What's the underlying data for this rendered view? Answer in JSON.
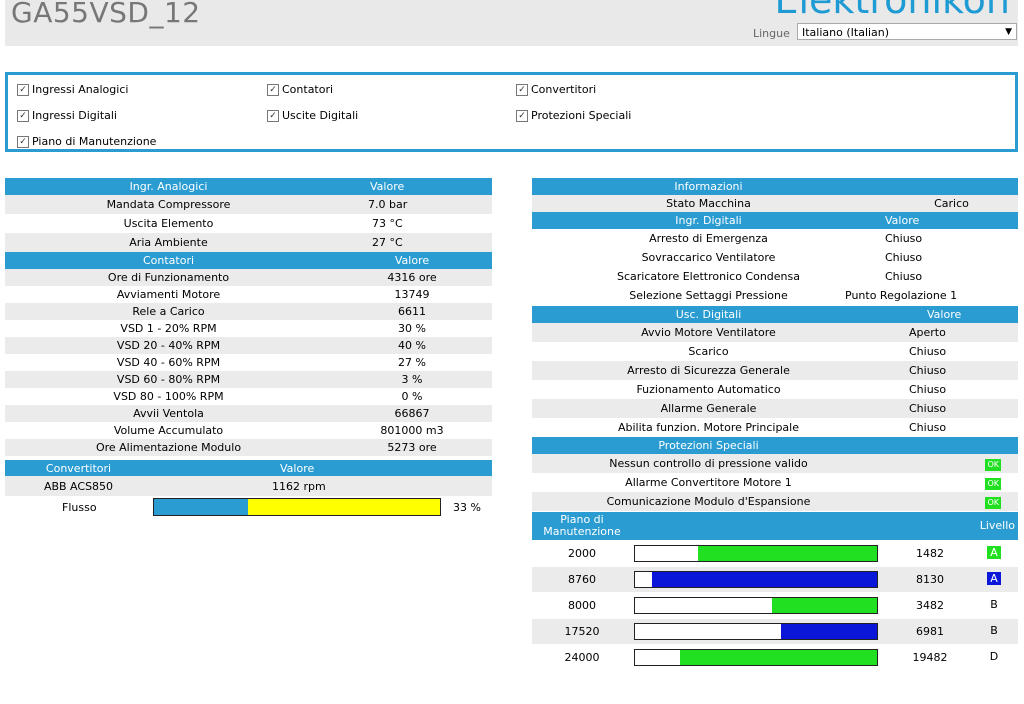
{
  "header": {
    "title": "GA55VSD_12",
    "brand": "Elektronikon",
    "language_label": "Lingue",
    "language_value": "Italiano (Italian)"
  },
  "filters": [
    {
      "label": "Ingressi Analogici",
      "checked": true
    },
    {
      "label": "Contatori",
      "checked": true
    },
    {
      "label": "Convertitori",
      "checked": true
    },
    {
      "label": "Ingressi Digitali",
      "checked": true
    },
    {
      "label": "Uscite Digitali",
      "checked": true
    },
    {
      "label": "Protezioni Speciali",
      "checked": true
    },
    {
      "label": "Piano di Manutenzione",
      "checked": true
    }
  ],
  "left": {
    "analog": {
      "header": [
        "Ingr. Analogici",
        "Valore"
      ],
      "rows": [
        [
          "Mandata Compressore",
          "7.0 bar"
        ],
        [
          "Uscita Elemento",
          "73 °C"
        ],
        [
          "Aria Ambiente",
          "27 °C"
        ]
      ]
    },
    "counters": {
      "header": [
        "Contatori",
        "Valore"
      ],
      "rows": [
        [
          "Ore di Funzionamento",
          "4316 ore"
        ],
        [
          "Avviamenti Motore",
          "13749"
        ],
        [
          "Rele a Carico",
          "6611"
        ],
        [
          "VSD 1 - 20% RPM",
          "30 %"
        ],
        [
          "VSD 20 - 40% RPM",
          "40 %"
        ],
        [
          "VSD 40 - 60% RPM",
          "27 %"
        ],
        [
          "VSD 60 - 80% RPM",
          "3 %"
        ],
        [
          "VSD 80 - 100% RPM",
          "0 %"
        ],
        [
          "Avvii Ventola",
          "66867"
        ],
        [
          "Volume Accumulato",
          "801000 m3"
        ],
        [
          "Ore Alimentazione Modulo",
          "5273 ore"
        ]
      ]
    },
    "converters": {
      "header": [
        "Convertitori",
        "Valore"
      ],
      "rows": [
        [
          "ABB ACS850",
          "1162 rpm"
        ]
      ],
      "flow_label": "Flusso",
      "flow_value": "33 %",
      "flow_fraction": 0.33,
      "flow_colors": {
        "fill": "#2a9cd2",
        "rest": "#ffff00"
      }
    }
  },
  "right": {
    "info": {
      "header": "Informazioni",
      "rows": [
        [
          "Stato Macchina",
          "Carico"
        ]
      ]
    },
    "digital_inputs": {
      "header": [
        "Ingr. Digitali",
        "Valore"
      ],
      "rows": [
        [
          "Arresto di Emergenza",
          "Chiuso"
        ],
        [
          "Sovraccarico Ventilatore",
          "Chiuso"
        ],
        [
          "Scaricatore Elettronico Condensa",
          "Chiuso"
        ],
        [
          "Selezione Settaggi Pressione",
          "Punto Regolazione 1"
        ]
      ]
    },
    "digital_outputs": {
      "header": [
        "Usc. Digitali",
        "Valore"
      ],
      "rows": [
        [
          "Avvio Motore Ventilatore",
          "Aperto"
        ],
        [
          "Scarico",
          "Chiuso"
        ],
        [
          "Arresto di Sicurezza Generale",
          "Chiuso"
        ],
        [
          "Fuzionamento Automatico",
          "Chiuso"
        ],
        [
          "Allarme Generale",
          "Chiuso"
        ],
        [
          "Abilita funzion. Motore Principale",
          "Chiuso"
        ]
      ]
    },
    "protections": {
      "header": "Protezioni Speciali",
      "rows": [
        [
          "Nessun controllo di pressione valido",
          "OK"
        ],
        [
          "Allarme Convertitore Motore 1",
          "OK"
        ],
        [
          "Comunicazione Modulo d'Espansione",
          "OK"
        ]
      ]
    },
    "maintenance": {
      "header": [
        "Piano di Manutenzione",
        "Livello"
      ],
      "rows": [
        {
          "interval": "2000",
          "remaining": "1482",
          "level": "A",
          "fraction": 0.741,
          "color": "#21e021",
          "level_bg": "#21e021",
          "level_fg": "#ffffff"
        },
        {
          "interval": "8760",
          "remaining": "8130",
          "level": "A",
          "fraction": 0.928,
          "color": "#0a17d8",
          "level_bg": "#0a17d8",
          "level_fg": "#ffffff"
        },
        {
          "interval": "8000",
          "remaining": "3482",
          "level": "B",
          "fraction": 0.435,
          "color": "#21e021",
          "level_bg": "",
          "level_fg": "#000000"
        },
        {
          "interval": "17520",
          "remaining": "6981",
          "level": "B",
          "fraction": 0.398,
          "color": "#0a17d8",
          "level_bg": "",
          "level_fg": "#000000"
        },
        {
          "interval": "24000",
          "remaining": "19482",
          "level": "D",
          "fraction": 0.812,
          "color": "#21e021",
          "level_bg": "",
          "level_fg": "#000000"
        }
      ]
    }
  }
}
